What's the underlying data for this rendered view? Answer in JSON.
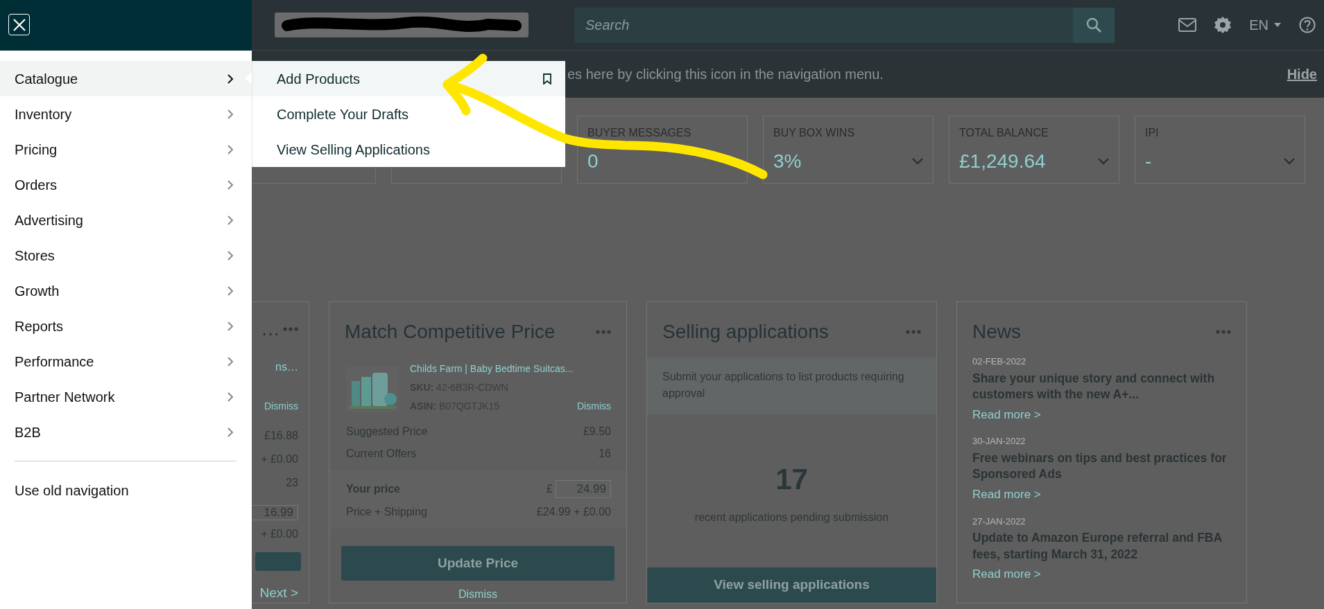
{
  "drawer": {
    "items": [
      {
        "label": "Catalogue",
        "selected": true
      },
      {
        "label": "Inventory",
        "selected": false
      },
      {
        "label": "Pricing",
        "selected": false
      },
      {
        "label": "Orders",
        "selected": false
      },
      {
        "label": "Advertising",
        "selected": false
      },
      {
        "label": "Stores",
        "selected": false
      },
      {
        "label": "Growth",
        "selected": false
      },
      {
        "label": "Reports",
        "selected": false
      },
      {
        "label": "Performance",
        "selected": false
      },
      {
        "label": "Partner Network",
        "selected": false
      },
      {
        "label": "B2B",
        "selected": false
      }
    ],
    "footer_link": "Use old navigation"
  },
  "submenu": {
    "items": [
      {
        "label": "Add Products",
        "selected": true
      },
      {
        "label": "Complete Your Drafts",
        "selected": false
      },
      {
        "label": "View Selling Applications",
        "selected": false
      }
    ]
  },
  "top_bar": {
    "search_placeholder": "Search",
    "language": "EN"
  },
  "banner": {
    "text": "es here by clicking this icon in the navigation menu.",
    "hide": "Hide"
  },
  "metrics": [
    {
      "kind": "covered"
    },
    {
      "kind": "covered"
    },
    {
      "kind": "metric",
      "label": "BUYER MESSAGES",
      "value": "0"
    },
    {
      "kind": "dropdown",
      "label": "BUY BOX WINS",
      "value": "3%"
    },
    {
      "kind": "dropdown",
      "label": "TOTAL BALANCE",
      "value": "£1,249.64"
    },
    {
      "kind": "dropdown",
      "label": "IPI",
      "value": "-"
    }
  ],
  "widgets": [
    {
      "kind": "partial",
      "title": "…",
      "link": "ns…",
      "dismiss": "Dismiss",
      "values": [
        "£16.88",
        "+ £0.00",
        "23"
      ],
      "price_input": "16.99",
      "shipping": "+ £0.00",
      "next": "Next >"
    },
    {
      "kind": "price",
      "title": "Match Competitive Price",
      "product": {
        "name": "Childs Farm | Baby Bedtime Suitcas...",
        "sku": "**SKU:** 42-6B3R-CDWN",
        "asin": "**ASIN:** B07QGTJK15",
        "dismiss": "Dismiss"
      },
      "rows": [
        {
          "label": "Suggested Price",
          "value": "£9.50"
        },
        {
          "label": "Current Offers",
          "value": "16"
        }
      ],
      "your_price": {
        "label": "Your price",
        "currency": "£",
        "value": "24.99"
      },
      "shipping": {
        "label": "Price + Shipping",
        "value": "£24.99 + £0.00"
      },
      "button": "Update Price",
      "dismiss": "Dismiss"
    },
    {
      "kind": "applications",
      "title": "Selling applications",
      "notice": "Submit your applications to list products requiring approval",
      "count": "17",
      "caption": "recent applications pending submission",
      "button": "View selling applications"
    },
    {
      "kind": "news",
      "title": "News",
      "entries": [
        {
          "date": "02-FEB-2022",
          "headline": "Share your unique story and connect with customers with the new A+...",
          "link": "Read more >"
        },
        {
          "date": "30-JAN-2022",
          "headline": "Free webinars on tips and best practices for Sponsored Ads",
          "link": "Read more >"
        },
        {
          "date": "27-JAN-2022",
          "headline": "Update to Amazon Europe referral and FBA fees, starting March 31, 2022",
          "link": "Read more >"
        }
      ]
    }
  ]
}
